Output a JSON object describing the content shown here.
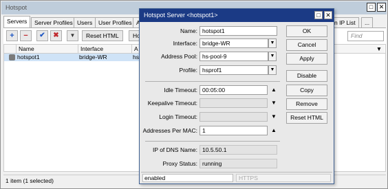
{
  "window": {
    "title": "Hotspot"
  },
  "tabs": [
    {
      "label": "Servers"
    },
    {
      "label": "Server Profiles"
    },
    {
      "label": "Users"
    },
    {
      "label": "User Profiles"
    },
    {
      "label": "A"
    },
    {
      "label": "n IP List"
    },
    {
      "label": "..."
    }
  ],
  "toolbar": {
    "add_glyph": "+",
    "remove_glyph": "−",
    "enable_glyph": "✔",
    "disable_glyph": "✖",
    "filter_glyph": "▼",
    "reset_html_label": "Reset HTML",
    "partial_label": "Ho",
    "find_placeholder": "Find"
  },
  "table": {
    "columns": [
      "Name",
      "Interface",
      "A"
    ],
    "rows": [
      {
        "name": "hotspot1",
        "interface": "bridge-WR",
        "address": "hs"
      }
    ]
  },
  "statusbar": {
    "text": "1 item (1 selected)"
  },
  "dialog": {
    "title": "Hotspot Server <hotspot1>",
    "fields": {
      "name": {
        "label": "Name:",
        "value": "hotspot1"
      },
      "interface": {
        "label": "Interface:",
        "value": "bridge-WR"
      },
      "address_pool": {
        "label": "Address Pool:",
        "value": "hs-pool-9"
      },
      "profile": {
        "label": "Profile:",
        "value": "hsprof1"
      },
      "idle_timeout": {
        "label": "Idle Timeout:",
        "value": "00:05:00"
      },
      "keepalive_timeout": {
        "label": "Keepalive Timeout:",
        "value": ""
      },
      "login_timeout": {
        "label": "Login Timeout:",
        "value": ""
      },
      "addresses_per_mac": {
        "label": "Addresses Per MAC:",
        "value": "1"
      },
      "ip_of_dns_name": {
        "label": "IP of DNS Name:",
        "value": "10.5.50.1"
      },
      "proxy_status": {
        "label": "Proxy Status:",
        "value": "running"
      }
    },
    "buttons": {
      "ok": "OK",
      "cancel": "Cancel",
      "apply": "Apply",
      "disable": "Disable",
      "copy": "Copy",
      "remove": "Remove",
      "reset_html": "Reset HTML"
    },
    "status": {
      "left": "enabled",
      "right": "HTTPS"
    }
  },
  "colors": {
    "dialog_titlebar": "#1b3a85",
    "selected_row": "#cfe3f7",
    "add_icon": "#1f57c3",
    "remove_icon": "#c0282d"
  }
}
